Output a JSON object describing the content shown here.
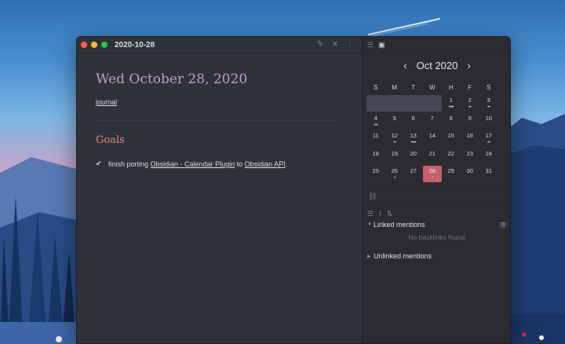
{
  "window": {
    "title": "2020-10-28"
  },
  "editor": {
    "heading": "Wed October 28, 2020",
    "tag_link": "journal",
    "section_heading": "Goals",
    "task": {
      "prefix": "finish porting ",
      "link1": "Obsidian - Calendar Plugin",
      "middle": " to ",
      "link2": "Obsidian API",
      "suffix": "."
    }
  },
  "calendar": {
    "month_label": "Oct 2020",
    "prev": "‹",
    "next": "›",
    "weekdays": [
      "S",
      "M",
      "T",
      "W",
      "H",
      "F",
      "S"
    ],
    "weeks": [
      [
        {
          "d": ""
        },
        {
          "d": ""
        },
        {
          "d": ""
        },
        {
          "d": ""
        },
        {
          "d": "1",
          "dots": "••••"
        },
        {
          "d": "2",
          "dots": "••"
        },
        {
          "d": "3",
          "dots": "••"
        }
      ],
      [
        {
          "d": "4",
          "dots": "•••"
        },
        {
          "d": "5"
        },
        {
          "d": "6"
        },
        {
          "d": "7"
        },
        {
          "d": "8"
        },
        {
          "d": "9"
        },
        {
          "d": "10"
        }
      ],
      [
        {
          "d": "11"
        },
        {
          "d": "12",
          "dots": "••"
        },
        {
          "d": "13",
          "dots": "••••"
        },
        {
          "d": "14"
        },
        {
          "d": "15"
        },
        {
          "d": "16"
        },
        {
          "d": "17",
          "dots": "••"
        }
      ],
      [
        {
          "d": "18"
        },
        {
          "d": "19"
        },
        {
          "d": "20"
        },
        {
          "d": "21"
        },
        {
          "d": "22"
        },
        {
          "d": "23"
        },
        {
          "d": "24"
        }
      ],
      [
        {
          "d": "25"
        },
        {
          "d": "26",
          "dots": "•"
        },
        {
          "d": "27"
        },
        {
          "d": "28",
          "today": true,
          "dots": "•"
        },
        {
          "d": "29"
        },
        {
          "d": "30"
        },
        {
          "d": "31"
        }
      ]
    ]
  },
  "backlinks": {
    "linked_label": "Linked mentions",
    "linked_count": "0",
    "empty_text": "No backlinks found.",
    "unlinked_label": "Unlinked mentions"
  },
  "icons": {
    "toolbar": [
      "list-icon",
      "calendar-icon"
    ],
    "title_actions": [
      "edit-icon",
      "close-icon",
      "more-icon"
    ]
  },
  "colors": {
    "heading": "#c59bc9",
    "section_heading": "#e08a7a",
    "today": "#c7606b"
  }
}
